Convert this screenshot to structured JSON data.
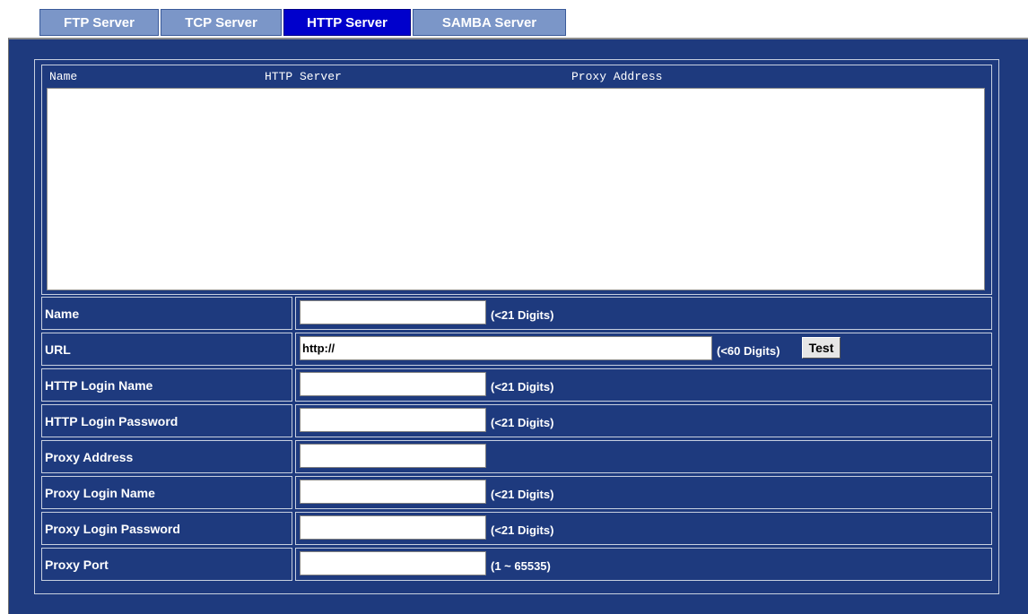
{
  "tabs": [
    "FTP Server",
    "TCP Server",
    "HTTP Server",
    "SAMBA Server"
  ],
  "active_tab": "HTTP Server",
  "list": {
    "headers": [
      "Name",
      "HTTP Server",
      "Proxy Address"
    ]
  },
  "fields": {
    "name": {
      "label": "Name",
      "value": "",
      "hint": "(<21 Digits)"
    },
    "url": {
      "label": "URL",
      "value": "http://",
      "hint": "(<60 Digits)",
      "button": "Test"
    },
    "http_login_name": {
      "label": "HTTP Login Name",
      "value": "",
      "hint": "(<21 Digits)"
    },
    "http_login_password": {
      "label": "HTTP Login Password",
      "value": "",
      "hint": "(<21 Digits)"
    },
    "proxy_address": {
      "label": "Proxy Address",
      "value": ""
    },
    "proxy_login_name": {
      "label": "Proxy Login Name",
      "value": "",
      "hint": "(<21 Digits)"
    },
    "proxy_login_password": {
      "label": "Proxy Login Password",
      "value": "",
      "hint": "(<21 Digits)"
    },
    "proxy_port": {
      "label": "Proxy Port",
      "value": "",
      "hint": "(1 ~ 65535)"
    }
  }
}
